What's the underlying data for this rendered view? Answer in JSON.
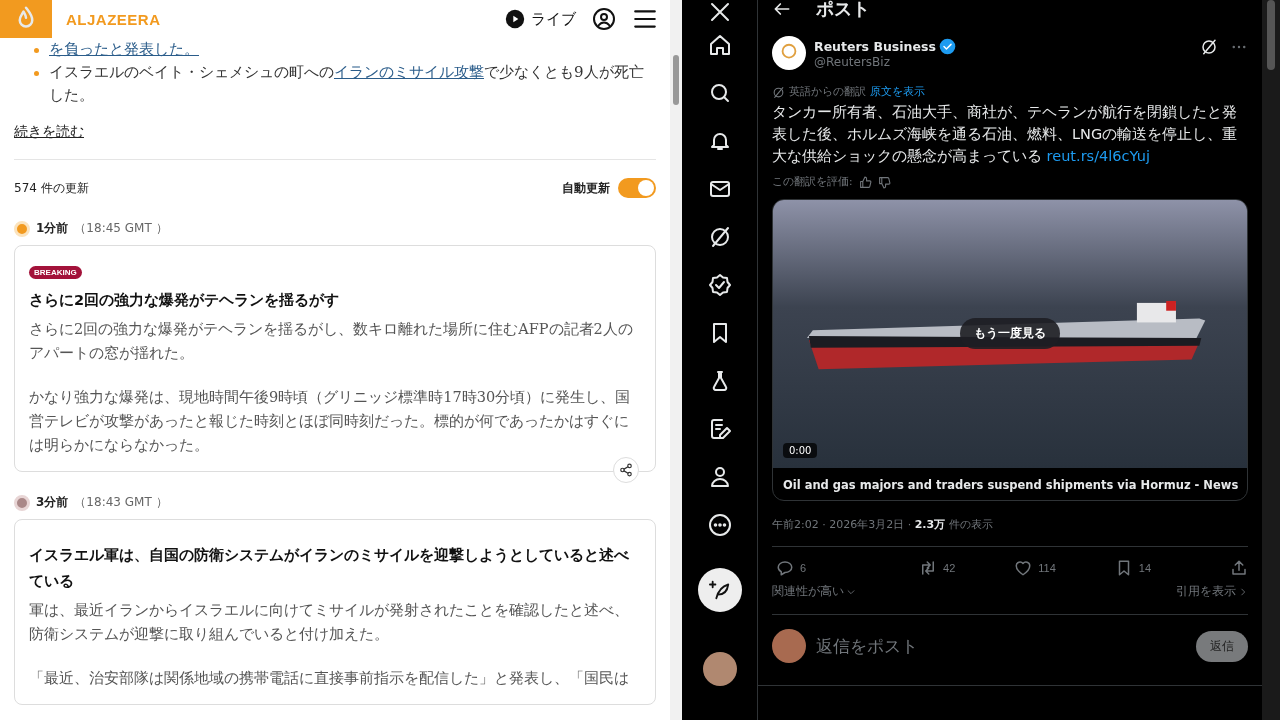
{
  "news": {
    "logo_text": "ALJAZEERA",
    "live_label": "ライブ",
    "bullets": [
      {
        "segments": [
          {
            "text": "を負ったと発表した。",
            "link": true
          }
        ]
      },
      {
        "segments": [
          {
            "text": "イスラエルのベイト・シェメシュの町への",
            "link": false
          },
          {
            "text": "イランのミサイル攻撃",
            "link": true
          },
          {
            "text": "で少なくとも9人が死亡した。",
            "link": false
          }
        ]
      }
    ],
    "read_more": "続きを読む",
    "updates_count": "574 件の更新",
    "auto_update": {
      "label": "自動更新",
      "on": true
    },
    "updates": [
      {
        "time_ago": "1分前",
        "time": "（18:45 GMT ）",
        "latest": true,
        "badge": "BREAKING",
        "title": "さらに2回の強力な爆発がテヘランを揺るがす",
        "paragraphs": [
          "さらに2回の強力な爆発がテヘランを揺るがし、数キロ離れた場所に住むAFPの記者2人のアパートの窓が揺れた。",
          "かなり強力な爆発は、現地時間午後9時頃（グリニッジ標準時17時30分頃）に発生し、国営テレビが攻撃があったと報じた時刻とほぼ同時刻だった。標的が何であったかはすぐには明らかにならなかった。"
        ],
        "share": true
      },
      {
        "time_ago": "3分前",
        "time": "（18:43 GMT ）",
        "latest": false,
        "title": "イスラエル軍は、自国の防衛システムがイランのミサイルを迎撃しようとしていると述べている",
        "paragraphs": [
          "軍は、最近イランからイスラエルに向けてミサイルが発射されたことを確認したと述べ、防衛システムが迎撃に取り組んでいると付け加えた。",
          "「最近、治安部隊は関係地域の携帯電話に直接事前指示を配信した」と発表し、「国民は"
        ],
        "share": false
      }
    ]
  },
  "social": {
    "header_title": "ポスト",
    "post": {
      "author": "Reuters Business",
      "verified": true,
      "handle": "@ReutersBiz",
      "translation_note": "英語からの翻訳",
      "show_original": "原文を表示",
      "text": "タンカー所有者、石油大手、商社が、テヘランが航行を閉鎖したと発表した後、ホルムズ海峡を通る石油、燃料、LNGの輸送を停止し、重大な供給ショックの懸念が高まっている",
      "link": "reut.rs/4l6cYuj",
      "rate_label": "この翻訳を評価:",
      "video": {
        "replay": "もう一度見る",
        "time": "0:00",
        "caption": "Oil and gas majors and traders suspend shipments via Hormuz - News"
      },
      "meta": "午前2:02 · 2026年3月2日 · ",
      "views": "2.3万",
      "views_label": "件の表示",
      "actions": [
        {
          "kind": "reply",
          "count": "6"
        },
        {
          "kind": "repost",
          "count": "42"
        },
        {
          "kind": "like",
          "count": "114"
        },
        {
          "kind": "bookmark",
          "count": "14"
        },
        {
          "kind": "share"
        }
      ],
      "sort": "関連性が高い",
      "quotes": "引用を表示",
      "reply_placeholder": "返信をポスト",
      "reply_button": "返信"
    }
  }
}
